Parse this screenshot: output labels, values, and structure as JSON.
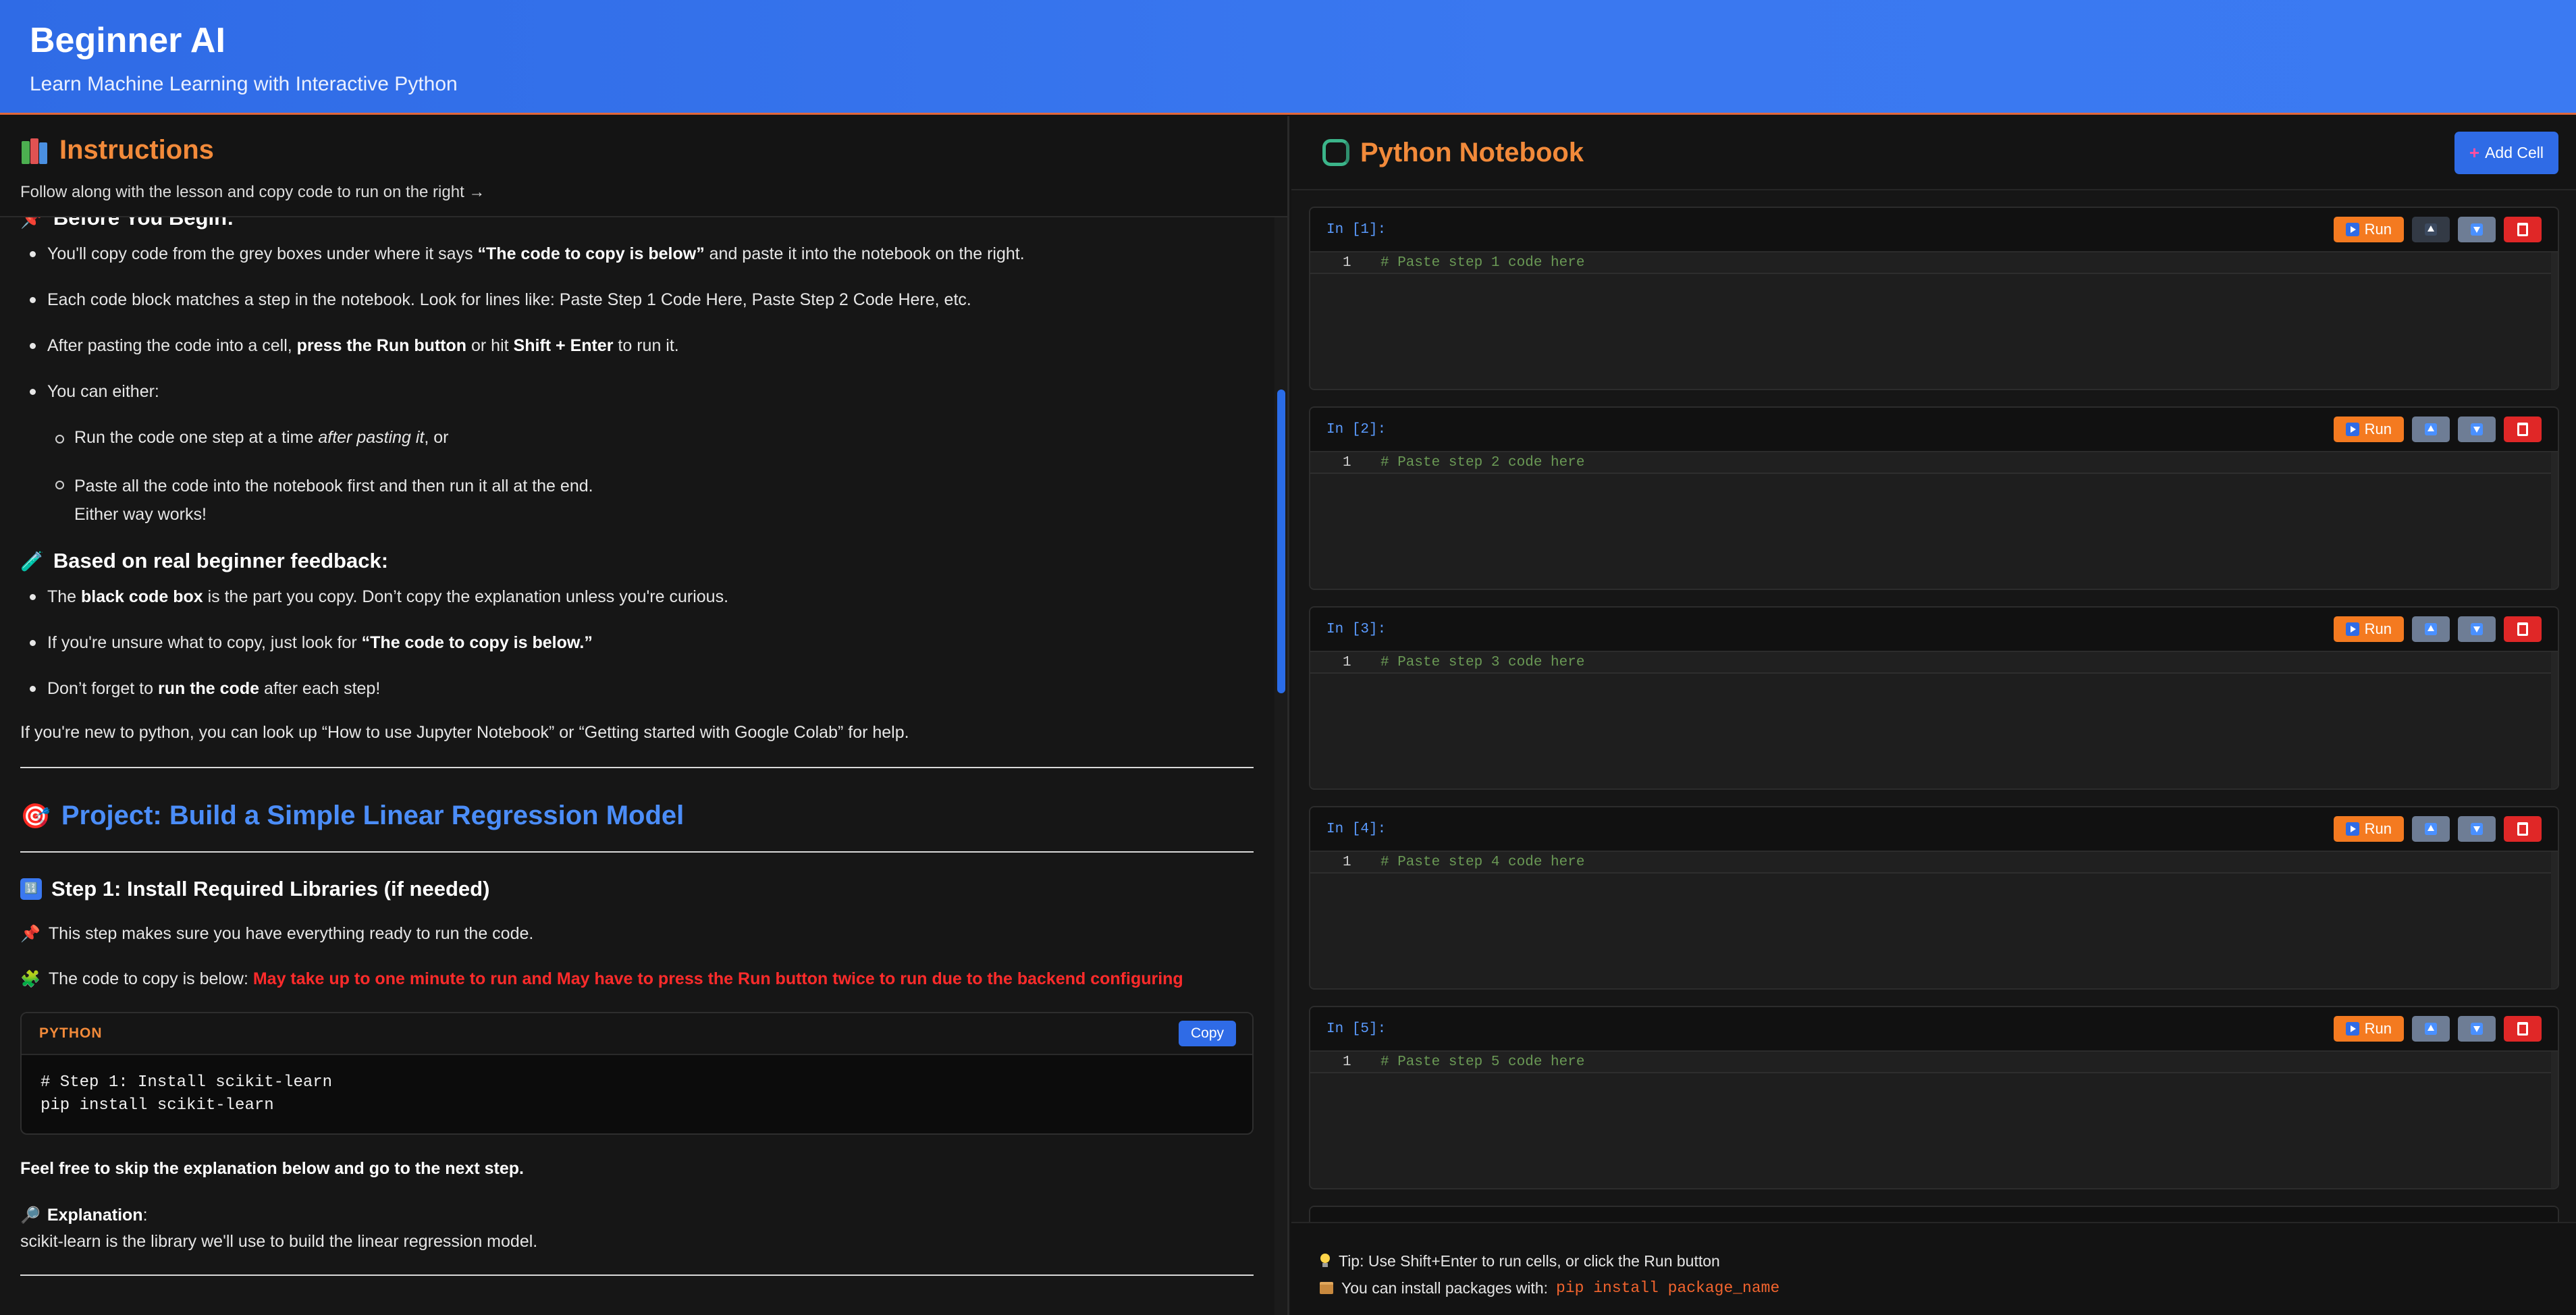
{
  "app": {
    "title": "Beginner AI",
    "subtitle": "Learn Machine Learning with Interactive Python"
  },
  "instructions": {
    "title": "Instructions",
    "hint": "Follow along with the lesson and copy code to run on the right →",
    "before_heading": "Before You Begin:",
    "bullets": [
      {
        "pre": "You'll copy code from the grey boxes under where it says ",
        "bold": "“The code to copy is below”",
        "post": " and paste it into the notebook on the right."
      },
      {
        "pre": "Each code block matches a step in the notebook. Look for lines like: Paste Step 1 Code Here, Paste Step 2 Code Here, etc.",
        "bold": "",
        "post": ""
      },
      {
        "pre": "After pasting the code into a cell, ",
        "bold": "press the Run button",
        "mid": " or hit ",
        "bold2": "Shift + Enter",
        "post": " to run it."
      },
      {
        "pre": "You can either:",
        "bold": "",
        "post": ""
      }
    ],
    "sub_bullets": [
      {
        "pre": "Run the code one step at a time ",
        "italic": "after pasting it",
        "post": ", or"
      },
      {
        "line1": "Paste all the code into the notebook first and then run it all at the end.",
        "line2": "Either way works!"
      }
    ],
    "feedback_heading": "Based on real beginner feedback:",
    "feedback": [
      {
        "pre": "The ",
        "bold": "black code box",
        "post": " is the part you copy. Don’t copy the explanation unless you're curious."
      },
      {
        "pre": "If you're unsure what to copy, just look for ",
        "bold": "“The code to copy is below.”",
        "post": ""
      },
      {
        "pre": "Don’t forget to ",
        "bold": "run the code",
        "post": " after each step!"
      }
    ],
    "new_to_python": "If you're new to python, you can look up “How to use Jupyter Notebook” or “Getting started with Google Colab” for help.",
    "project_title": "Project: Build a Simple Linear Regression Model",
    "step1_title": "Step 1: Install Required Libraries (if needed)",
    "step1_note": "This step makes sure you have everything ready to run the code.",
    "copy_label": "The code to copy is below: ",
    "copy_warning": "May take up to one minute to run and May have to press the Run button twice to run due to the backend configuring",
    "code_lang": "PYTHON",
    "copy_button": "Copy",
    "code_lines": [
      "# Step 1: Install scikit-learn",
      "pip install scikit-learn"
    ],
    "skip_note": "Feel free to skip the explanation below and go to the next step.",
    "explanation_label": "Explanation",
    "explanation_text": "scikit-learn is the library we'll use to build the linear regression model."
  },
  "notebook": {
    "title": "Python Notebook",
    "add_cell": "Add Cell",
    "run_label": "Run",
    "cells": [
      {
        "label": "In [1]:",
        "line_no": "1",
        "code": "# Paste step 1 code here"
      },
      {
        "label": "In [2]:",
        "line_no": "1",
        "code": "# Paste step 2 code here"
      },
      {
        "label": "In [3]:",
        "line_no": "1",
        "code": "# Paste step 3 code here"
      },
      {
        "label": "In [4]:",
        "line_no": "1",
        "code": "# Paste step 4 code here"
      },
      {
        "label": "In [5]:",
        "line_no": "1",
        "code": "# Paste step 5 code here"
      }
    ],
    "tip1": "Tip: Use Shift+Enter to run cells, or click the Run button",
    "tip2": "You can install packages with:",
    "tip2_code": "pip install package_name"
  },
  "colors": {
    "header_blue": "#3a78f0",
    "accent_orange": "#f28a3a",
    "project_blue": "#4b8df8",
    "warning_red": "#ff2b2b",
    "run_orange": "#f47a20",
    "delete_red": "#e02727"
  }
}
